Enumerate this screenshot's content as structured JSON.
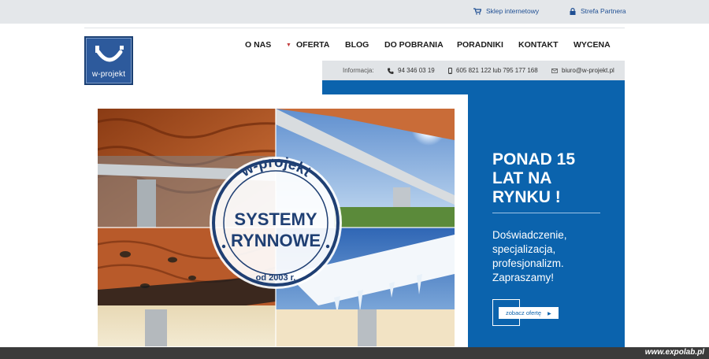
{
  "topbar": {
    "shop": {
      "label": "Sklep internetowy",
      "icon": "cart-icon"
    },
    "partner": {
      "label": "Strefa Partnera",
      "icon": "lock-icon"
    }
  },
  "logo": {
    "text": "w-projekt"
  },
  "nav": {
    "items": [
      {
        "label": "O NAS"
      },
      {
        "label": "OFERTA",
        "has_dropdown": true
      },
      {
        "label": "BLOG"
      },
      {
        "label": "DO POBRANIA"
      },
      {
        "label": "PORADNIKI"
      },
      {
        "label": "KONTAKT"
      },
      {
        "label": "WYCENA"
      }
    ]
  },
  "info": {
    "label": "Informacja:",
    "phone": "94 346 03 19",
    "mobile1": "605 821 122",
    "mobile_sep": "lub",
    "mobile2": "795 177 168",
    "email": "biuro@w-projekt.pl"
  },
  "hero": {
    "badge": {
      "top_text": "w-projekt",
      "line1": "SYSTEMY",
      "line2": "RYNNOWE",
      "since": "od 2003 r."
    },
    "title": "PONAD 15 LAT NA RYNKU !",
    "text": "Doświadczenie, specjalizacja, profesjonalizm. Zapraszamy!",
    "button": "zobacz ofertę"
  },
  "watermark": "www.expolab.pl",
  "colors": {
    "brand_blue": "#0b63ad",
    "dark_blue": "#1a3f73",
    "accent_red": "#c23b3b"
  }
}
